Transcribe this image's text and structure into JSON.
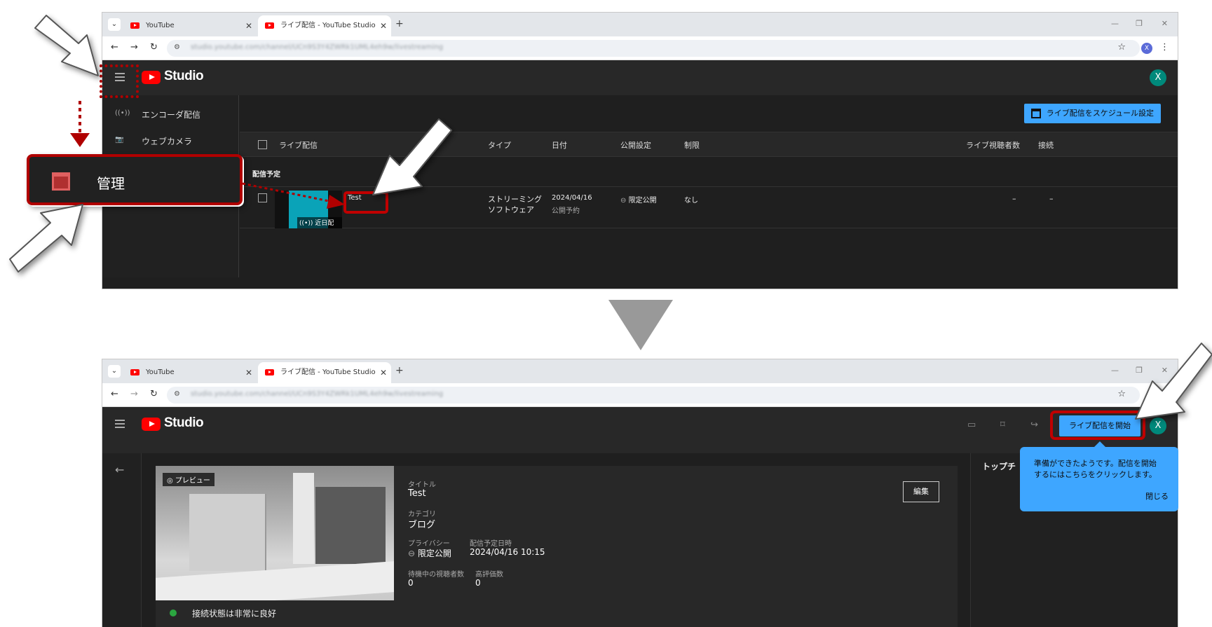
{
  "browser": {
    "tabs": [
      {
        "title": "YouTube"
      },
      {
        "title": "ライブ配信 - YouTube Studio"
      }
    ],
    "new_tab": "+",
    "url": "studio.youtube.com/channel/UCn9S3Y4ZWRk1UML4eh9w/livestreaming",
    "profile_initial": "X"
  },
  "studio": {
    "logo_text": "Studio",
    "avatar_initial": "X"
  },
  "top": {
    "sidebar": [
      {
        "label": "エンコーダ配信",
        "icon": "broadcast-icon"
      },
      {
        "label": "ウェブカメラ",
        "icon": "camera-icon"
      }
    ],
    "callout_label": "管理",
    "schedule_button": "ライブ配信をスケジュール設定",
    "table": {
      "headers": [
        "ライブ配信",
        "タイプ",
        "日付",
        "公開設定",
        "制限",
        "ライブ視聴者数",
        "接続"
      ],
      "section": "配信予定",
      "row": {
        "title": "Test",
        "badge": "近日配信",
        "type_line1": "ストリーミング",
        "type_line2": "ソフトウェア",
        "date": "2024/04/16",
        "date_sub": "公開予約",
        "visibility": "限定公開",
        "restriction": "なし",
        "viewers": "–",
        "connection": "–"
      }
    }
  },
  "bottom": {
    "preview_label": "プレビュー",
    "title_label": "タイトル",
    "title_value": "Test",
    "category_label": "カテゴリ",
    "category_value": "ブログ",
    "privacy_label": "プライバシー",
    "privacy_value": "限定公開",
    "schedule_label": "配信予定日時",
    "schedule_value": "2024/04/16 10:15",
    "waiting_label": "待機中の視聴者数",
    "waiting_value": "0",
    "likes_label": "高評価数",
    "likes_value": "0",
    "edit_button": "編集",
    "connection_status": "接続状態は非常に良好",
    "right_pane_title": "トップチ",
    "go_live_button": "ライブ配信を開始",
    "tooltip_text": "準備ができたようです。配信を開始するにはこちらをクリックします。",
    "tooltip_close": "閉じる"
  },
  "colors": {
    "accent": "#3ea6ff",
    "highlight_red": "#c00000",
    "studio_bg": "#1f1f1f",
    "status_good": "#2ba640"
  }
}
